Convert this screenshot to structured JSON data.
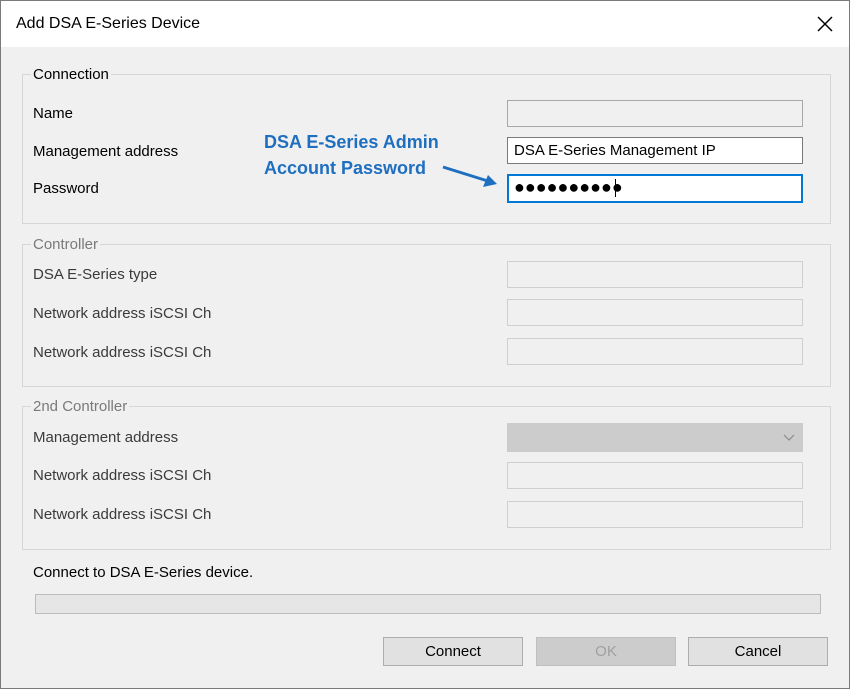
{
  "window": {
    "title": "Add DSA E-Series Device"
  },
  "connection": {
    "group_label": "Connection",
    "name_label": "Name",
    "name_value": "",
    "mgmt_label": "Management address",
    "mgmt_value": "DSA E-Series Management IP",
    "password_label": "Password",
    "password_dots": "●●●●●●●●●●"
  },
  "annotation": {
    "line1": "DSA E-Series Admin",
    "line2": "Account  Password",
    "color": "#1f6fc0"
  },
  "controller": {
    "group_label": "Controller",
    "type_label": "DSA E-Series type",
    "iscsi1_label": "Network address iSCSI Ch",
    "iscsi2_label": "Network address iSCSI Ch"
  },
  "controller2": {
    "group_label": "2nd Controller",
    "mgmt_label": "Management address",
    "mgmt_selected": "",
    "iscsi1_label": "Network address iSCSI Ch",
    "iscsi2_label": "Network address iSCSI Ch"
  },
  "status": {
    "text": "Connect to DSA E-Series device.",
    "progress": 0
  },
  "buttons": {
    "connect": "Connect",
    "ok": "OK",
    "cancel": "Cancel"
  },
  "icons": {
    "close": "close-icon",
    "dropdown": "chevron-down-icon",
    "arrow": "arrow-right-icon"
  }
}
